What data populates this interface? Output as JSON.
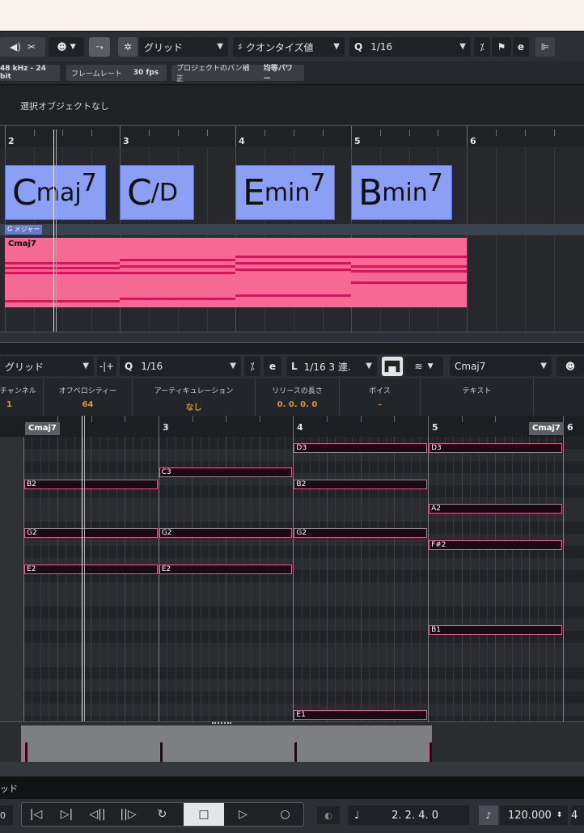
{
  "toolbar": {
    "snap_type": "グリッド",
    "quantize_label": "クオンタイズ値",
    "quantize_value": "1/16"
  },
  "infobar": {
    "audio_format": "48 kHz - 24 bit",
    "framerate_label": "フレームレート",
    "framerate_value": "30 fps",
    "pan_label": "プロジェクトのパン補正",
    "pan_value": "均等パワー"
  },
  "selection": {
    "none_text": "選択オブジェクトなし"
  },
  "arranger": {
    "bars": [
      "2",
      "3",
      "4",
      "5",
      "6"
    ],
    "chords": [
      {
        "root": "C",
        "quality": "maj",
        "ext": "7"
      },
      {
        "root": "C",
        "quality": "/D",
        "ext": ""
      },
      {
        "root": "E",
        "quality": "min",
        "ext": "7"
      },
      {
        "root": "B",
        "quality": "min",
        "ext": "7"
      }
    ],
    "scale_label": "G メジャー",
    "part_name": "Cmaj7"
  },
  "editor_toolbar": {
    "snap_type": "グリッド",
    "quantize_value": "1/16",
    "length_value": "1/16 3 連.",
    "chord_select": "Cmaj7"
  },
  "editor_info": {
    "channel_label": "チャンネル",
    "channel_value": "1",
    "offvel_label": "オフベロシティー",
    "offvel_value": "64",
    "artic_label": "アーティキュレーション",
    "artic_value": "なし",
    "release_label": "リリースの長さ",
    "release_value": "0. 0. 0.   0",
    "voice_label": "ボイス",
    "voice_value": "–",
    "text_label": "テキスト"
  },
  "editor_ruler": {
    "bars": [
      "3",
      "4",
      "5",
      "6"
    ],
    "chord_tags": [
      "Cmaj7",
      "Cmaj7"
    ]
  },
  "notes": [
    {
      "pitch": "D3",
      "start": 4,
      "end": 5
    },
    {
      "pitch": "D3",
      "start": 5,
      "end": 6
    },
    {
      "pitch": "C3",
      "start": 3,
      "end": 4
    },
    {
      "pitch": "B2",
      "start": 2,
      "end": 3
    },
    {
      "pitch": "B2",
      "start": 4,
      "end": 5
    },
    {
      "pitch": "A2",
      "start": 5,
      "end": 6
    },
    {
      "pitch": "G2",
      "start": 2,
      "end": 3
    },
    {
      "pitch": "G2",
      "start": 3,
      "end": 4
    },
    {
      "pitch": "G2",
      "start": 4,
      "end": 5
    },
    {
      "pitch": "F#2",
      "start": 5,
      "end": 6
    },
    {
      "pitch": "E2",
      "start": 2,
      "end": 3
    },
    {
      "pitch": "E2",
      "start": 3,
      "end": 4
    },
    {
      "pitch": "B1",
      "start": 5,
      "end": 6
    },
    {
      "pitch": "E1",
      "start": 4,
      "end": 5
    }
  ],
  "status": {
    "text": "ッド"
  },
  "transport": {
    "position": "2. 2. 4.   0",
    "tempo": "120.000",
    "left_value": "0",
    "right_value": "4"
  },
  "colors": {
    "chord_block": "#8b9ff4",
    "midi_part": "#f46a95",
    "note_border": "#e05c8e",
    "accent_value": "#d49a3e"
  }
}
